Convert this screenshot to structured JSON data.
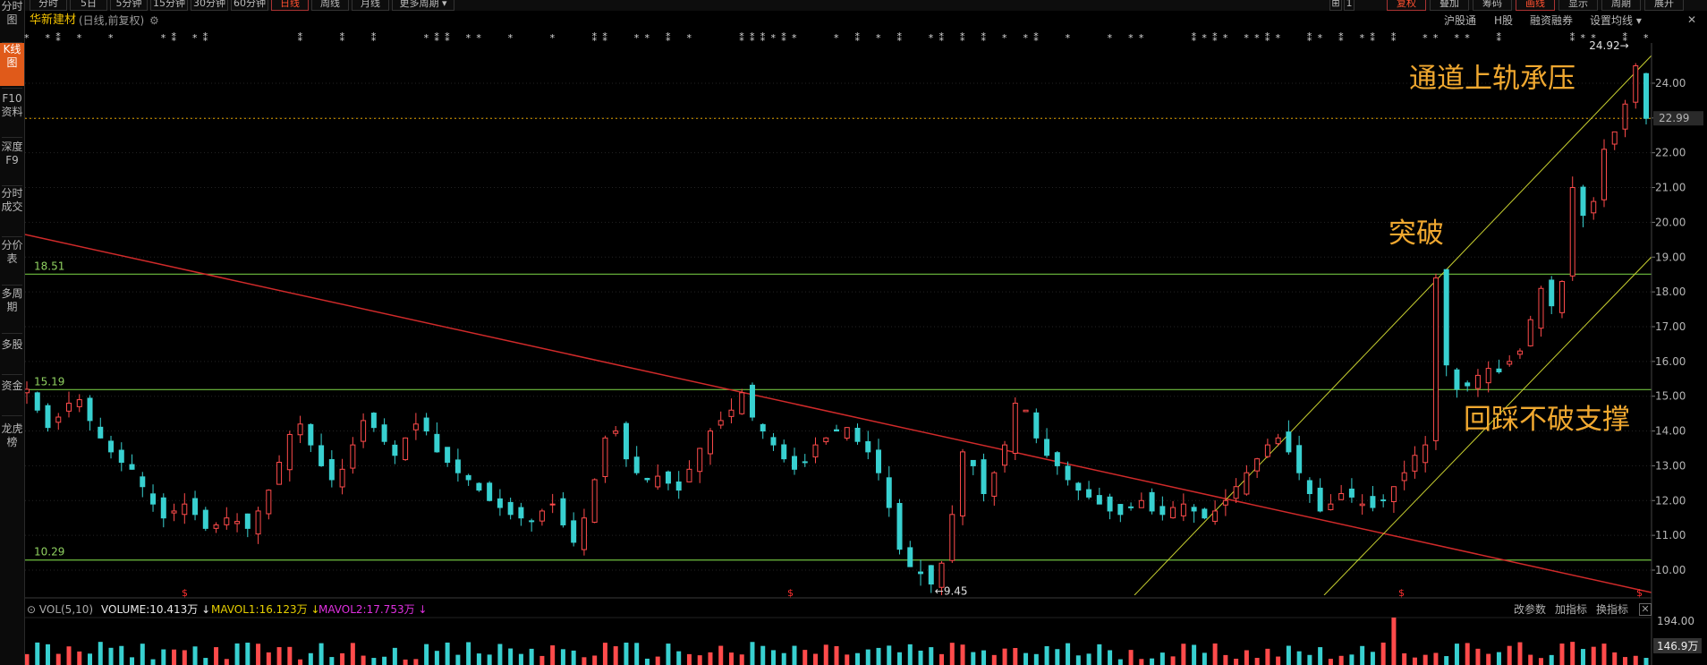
{
  "sidebar": {
    "items": [
      {
        "label": "分时图",
        "active": false
      },
      {
        "label": "K线图",
        "active": true
      },
      {
        "label": "F10资料",
        "active": false
      },
      {
        "label": "深度F9",
        "active": false
      },
      {
        "label": "分时成交",
        "active": false
      },
      {
        "label": "分价表",
        "active": false
      },
      {
        "label": "多周期",
        "active": false
      },
      {
        "label": "多股",
        "active": false
      },
      {
        "label": "资金",
        "active": false
      },
      {
        "label": "龙虎榜",
        "active": false
      }
    ]
  },
  "toolbar": {
    "periods": [
      "分时",
      "5日",
      "5分钟",
      "15分钟",
      "30分钟",
      "60分钟",
      "日线",
      "周线",
      "月线",
      "更多周期 ▾"
    ],
    "selected_period": "日线",
    "right_tabs": [
      "复权",
      "叠加",
      "筹码",
      "画线",
      "显示",
      "周期",
      "展开"
    ],
    "selected_right": [
      "复权",
      "画线"
    ]
  },
  "header": {
    "stock_name": "华新建材",
    "subtitle": "(日线,前复权)",
    "links": [
      "沪股通",
      "H股",
      "融资融券",
      "设置均线 ▾"
    ]
  },
  "chart_data": {
    "type": "candlestick",
    "price_axis": {
      "ticks": [
        10.0,
        11.0,
        12.0,
        13.0,
        14.0,
        15.0,
        16.0,
        17.0,
        18.0,
        19.0,
        20.0,
        21.0,
        22.0,
        23.0,
        24.0
      ],
      "labels": [
        "10.00",
        "11.00",
        "12.00",
        "13.00",
        "14.00",
        "15.00",
        "16.00",
        "17.00",
        "18.00",
        "19.00",
        "20.00",
        "21.00",
        "22.00",
        "23.00",
        "24.00"
      ]
    },
    "current_price": "22.99",
    "high_marker": "24.92",
    "low_marker": "9.45",
    "horizontal_levels": [
      {
        "label": "18.51",
        "value": 18.51
      },
      {
        "label": "15.19",
        "value": 15.19
      },
      {
        "label": "10.29",
        "value": 10.29
      }
    ],
    "annotations": [
      "通道上轨承压",
      "突破",
      "回踩不破支撑"
    ],
    "closes": [
      15.2,
      14.6,
      14.1,
      14.4,
      14.8,
      14.9,
      14.3,
      13.8,
      13.4,
      13.1,
      12.9,
      12.4,
      11.9,
      11.5,
      11.7,
      11.9,
      11.6,
      11.2,
      11.3,
      11.5,
      11.4,
      11.2,
      11.7,
      12.3,
      13.1,
      13.9,
      14.2,
      13.6,
      13.0,
      12.6,
      12.9,
      13.6,
      14.3,
      14.1,
      13.7,
      13.3,
      13.8,
      14.2,
      14.0,
      13.4,
      13.1,
      12.8,
      12.6,
      12.3,
      12.0,
      11.8,
      11.6,
      11.5,
      11.4,
      11.7,
      11.9,
      11.3,
      10.8,
      11.5,
      12.6,
      13.8,
      14.0,
      13.2,
      12.8,
      12.6,
      12.7,
      12.5,
      12.3,
      12.9,
      13.5,
      14.0,
      14.3,
      14.6,
      15.1,
      14.4,
      14.0,
      13.6,
      13.2,
      12.9,
      13.1,
      13.6,
      13.8,
      14.0,
      14.1,
      13.7,
      13.4,
      12.8,
      11.8,
      10.6,
      10.1,
      9.9,
      9.6,
      10.2,
      11.6,
      13.4,
      13.0,
      12.2,
      12.8,
      13.6,
      14.8,
      14.6,
      13.8,
      13.3,
      13.0,
      12.6,
      12.3,
      12.1,
      11.9,
      11.7,
      11.6,
      11.8,
      12.0,
      11.7,
      11.6,
      11.8,
      11.9,
      11.7,
      11.5,
      11.7,
      12.0,
      12.4,
      12.8,
      13.2,
      13.6,
      13.8,
      13.4,
      12.8,
      12.2,
      11.7,
      11.9,
      12.2,
      12.1,
      11.9,
      11.8,
      12.0,
      12.4,
      12.8,
      13.3,
      13.6,
      18.4,
      15.9,
      15.2,
      15.3,
      15.6,
      15.8,
      15.7,
      16.0,
      16.3,
      17.2,
      18.1,
      17.6,
      18.3,
      21.0,
      20.2,
      20.6,
      22.1,
      22.6,
      23.4,
      24.5,
      22.99
    ],
    "volume": {
      "label": "VOL(5,10)",
      "volume": "VOLUME:10.413万",
      "mavol1": "MAVOL1:16.123万",
      "mavol2": "MAVOL2:17.753万",
      "axis_top": "194.00",
      "axis_current": "146.9万"
    },
    "volume_panel_links": [
      "改参数",
      "加指标",
      "换指标"
    ]
  },
  "colors": {
    "up": "#ff4b4b",
    "down": "#38d0d0",
    "level_line": "#6fbf3f",
    "trend_line": "#d02a2a",
    "channel_line": "#c8d030",
    "annotation": "#f0a830",
    "title": "#f0c000"
  }
}
